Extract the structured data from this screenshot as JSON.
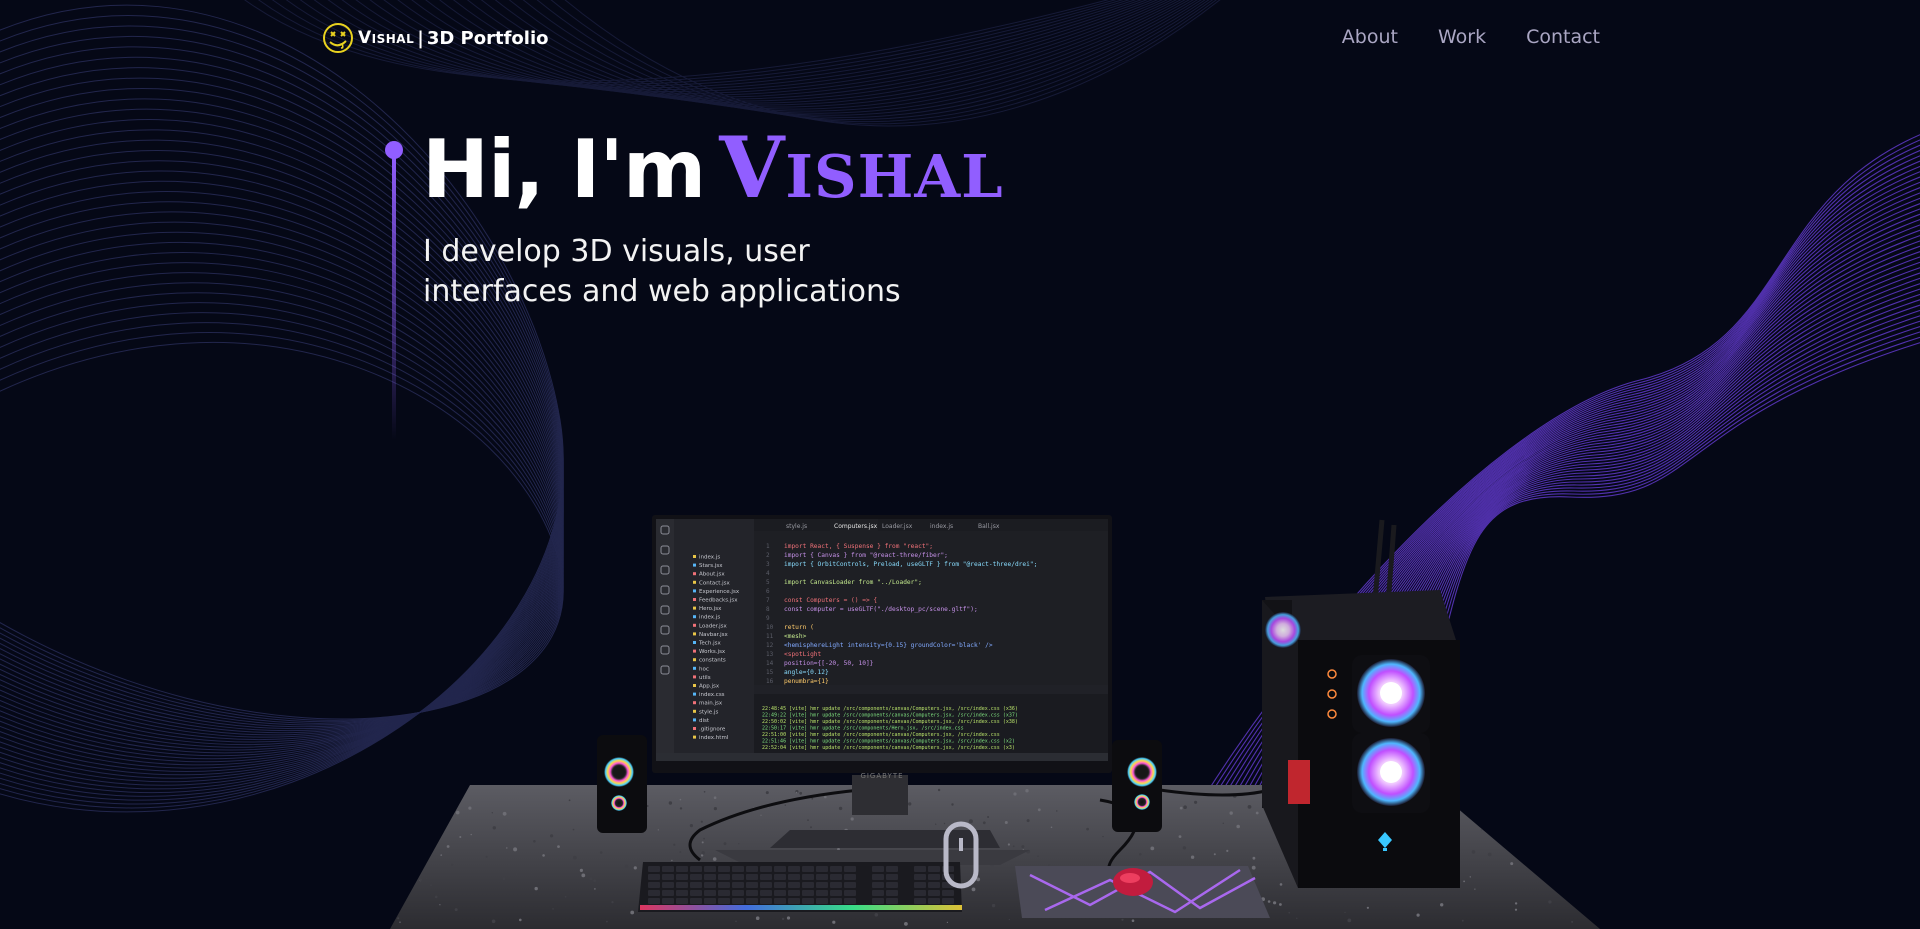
{
  "brand": {
    "name": "Vishal",
    "separator": "|",
    "subtitle": "3D Portfolio"
  },
  "nav": {
    "items": [
      {
        "label": "About"
      },
      {
        "label": "Work"
      },
      {
        "label": "Contact"
      }
    ]
  },
  "hero": {
    "greeting": "Hi, I'm",
    "name": "Vishal",
    "tagline_line1": "I develop 3D visuals, user",
    "tagline_line2": "interfaces and web applications"
  },
  "scene": {
    "monitor_brand": "GIGABYTE",
    "code_lines": [
      "import React, { Suspense } from \"react\";",
      "import { Canvas } from \"@react-three/fiber\";",
      "import { OrbitControls, Preload, useGLTF } from \"@react-three/drei\";",
      "",
      "import CanvasLoader from \"../Loader\";",
      "",
      "const Computers = () => {",
      "  const computer = useGLTF(\"./desktop_pc/scene.gltf\");",
      "",
      "  return (",
      "    <mesh>",
      "      <hemisphereLight intensity={0.15} groundColor='black' />",
      "      <spotLight",
      "        position={[-20, 50, 10]}",
      "        angle={0.12}",
      "        penumbra={1}"
    ],
    "file_tree": [
      "index.js",
      "Stars.jsx",
      "About.jsx",
      "Contact.jsx",
      "Experience.jsx",
      "Feedbacks.jsx",
      "Hero.jsx",
      "index.js",
      "Loader.jsx",
      "Navbar.jsx",
      "Tech.jsx",
      "Works.jsx",
      "constants",
      "hoc",
      "utils",
      "App.jsx",
      "index.css",
      "main.jsx",
      "style.js",
      "dist",
      ".gitignore",
      "index.html"
    ],
    "tabs": [
      "style.js",
      "Computers.jsx",
      "Loader.jsx",
      "index.js",
      "Ball.jsx"
    ],
    "terminal_lines": [
      "22:48:45 [vite] hmr update /src/components/canvas/Computers.jsx, /src/index.css (x36)",
      "22:49:22 [vite] hmr update /src/components/canvas/Computers.jsx, /src/index.css (x37)",
      "22:50:02 [vite] hmr update /src/components/canvas/Computers.jsx, /src/index.css (x38)",
      "22:50:17 [vite] hmr update /src/components/Hero.jsx, /src/index.css",
      "22:51:00 [vite] hmr update /src/components/canvas/Computers.jsx, /src/index.css",
      "22:51:46 [vite] hmr update /src/components/canvas/Computers.jsx, /src/index.css (x2)",
      "22:52:04 [vite] hmr update /src/components/canvas/Computers.jsx, /src/index.css (x3)"
    ]
  },
  "colors": {
    "background": "#050816",
    "accent": "#915eff",
    "nav_text": "#aaa6c3"
  }
}
